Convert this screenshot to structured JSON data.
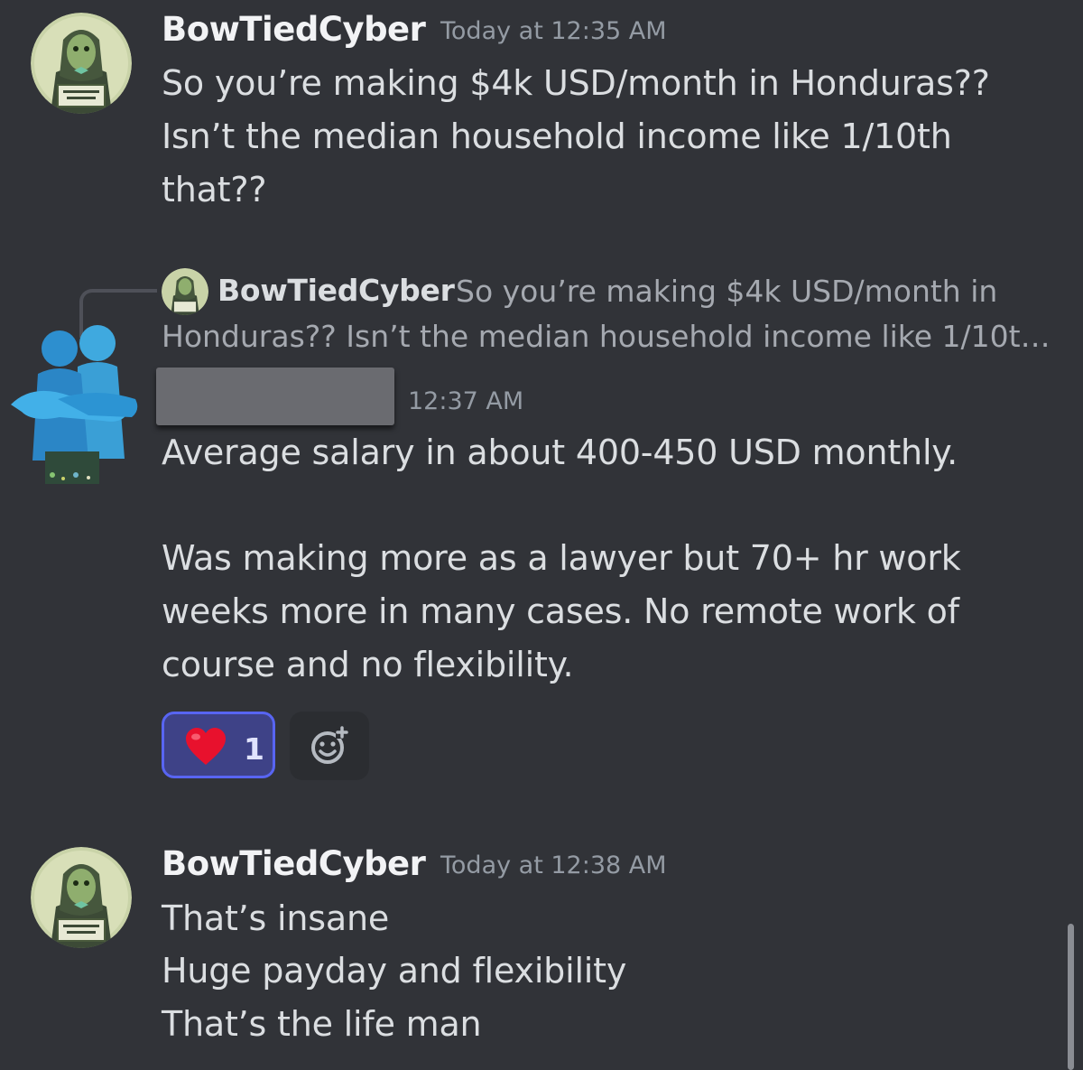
{
  "messages": [
    {
      "username": "BowTiedCyber",
      "timestamp": "Today at 12:35 AM",
      "lines": [
        "So you’re making $4k USD/month in Honduras??",
        "Isn’t the median household income like 1/10th",
        "that??"
      ]
    },
    {
      "reply": {
        "username": "BowTiedCyber",
        "text_line1": "So you’re making $4k USD/month in",
        "text_line2": "Honduras?? Isn’t the median household income like 1/10t…"
      },
      "timestamp_visible": "12:37 AM",
      "lines": [
        "Average salary in about 400-450 USD monthly.",
        "",
        "Was making more as a lawyer but  70+ hr work",
        "weeks more in many cases. No remote work of",
        "course and no flexibility."
      ],
      "reactions": [
        {
          "emoji": "❤️",
          "count": "1"
        }
      ]
    },
    {
      "username": "BowTiedCyber",
      "timestamp": "Today at 12:38 AM",
      "lines": [
        "That’s insane",
        "Huge payday and flexibility",
        "That’s the life man"
      ]
    }
  ],
  "colors": {
    "background": "#313338",
    "username": "#f2f3f5",
    "text": "#dbdee1",
    "timestamp": "#949ba4",
    "reaction_active_bg": "#3e4287",
    "reaction_active_border": "#5865f2"
  },
  "icons": {
    "avatar": "bowtie-avatar-icon",
    "hug_avatar": "hugging-people-icon",
    "add_reaction": "add-reaction-icon",
    "heart": "heart-icon"
  }
}
